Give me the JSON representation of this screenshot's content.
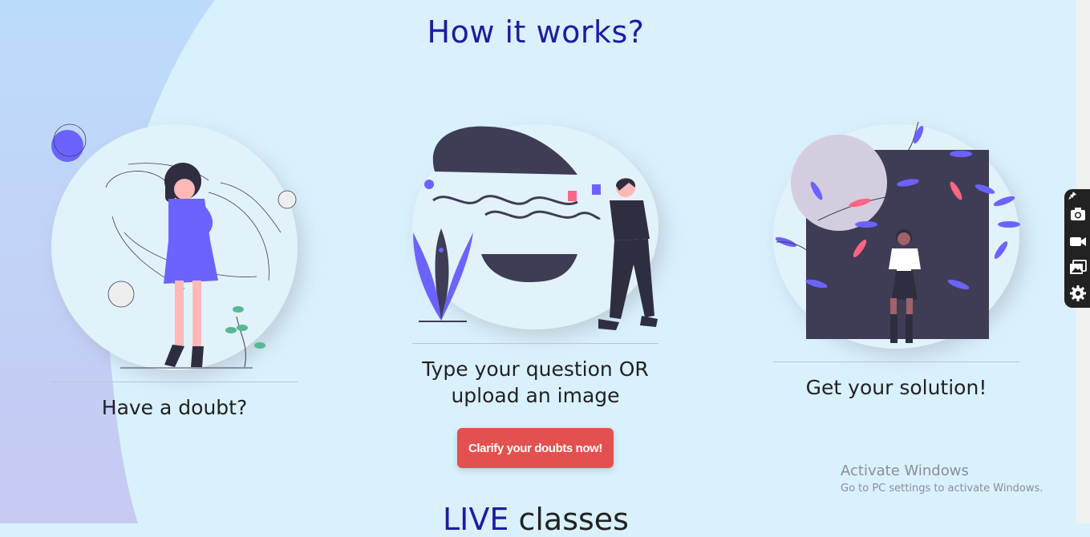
{
  "page": {
    "title": "How it works?",
    "next_section": {
      "accent": "LIVE",
      "rest": " classes"
    }
  },
  "steps": [
    {
      "caption_lines": [
        "Have a doubt?"
      ]
    },
    {
      "caption_lines": [
        "Type your question OR",
        "upload an image"
      ]
    },
    {
      "caption_lines": [
        "Get your solution!"
      ]
    }
  ],
  "cta": {
    "label": "Clarify your doubts now!"
  },
  "colors": {
    "background": "#d9f1fd",
    "title": "#1f1aa4",
    "cta": "#e4504f",
    "accent_purple": "#6c63ff",
    "dark": "#3f3d56"
  },
  "toolbar": {
    "icons": [
      "pin-icon",
      "camera-icon",
      "video-icon",
      "gallery-icon",
      "gear-icon"
    ]
  },
  "watermark": {
    "title": "Activate Windows",
    "subtitle": "Go to PC settings to activate Windows."
  }
}
